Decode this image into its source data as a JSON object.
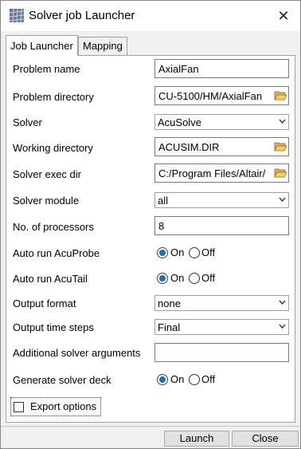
{
  "window": {
    "title": "Solver job Launcher",
    "close": "✕"
  },
  "tabs": [
    {
      "label": "Job Launcher",
      "active": true
    },
    {
      "label": "Mapping",
      "active": false
    }
  ],
  "form": {
    "problem_name": {
      "label": "Problem name",
      "value": "AxialFan"
    },
    "problem_directory": {
      "label": "Problem directory",
      "value": "CU-5100/HM/AxialFan"
    },
    "solver": {
      "label": "Solver",
      "value": "AcuSolve"
    },
    "working_directory": {
      "label": "Working directory",
      "value": "ACUSIM.DIR"
    },
    "solver_exec_dir": {
      "label": "Solver exec dir",
      "value": "C:/Program Files/Altair/"
    },
    "solver_module": {
      "label": "Solver module",
      "value": "all"
    },
    "num_processors": {
      "label": "No. of processors",
      "value": "8"
    },
    "auto_run_acuprobe": {
      "label": "Auto run AcuProbe",
      "on_label": "On",
      "off_label": "Off",
      "selected": "On"
    },
    "auto_run_acutail": {
      "label": "Auto run AcuTail",
      "on_label": "On",
      "off_label": "Off",
      "selected": "On"
    },
    "output_format": {
      "label": "Output format",
      "value": "none"
    },
    "output_time_steps": {
      "label": "Output time steps",
      "value": "Final"
    },
    "additional_args": {
      "label": "Additional solver arguments",
      "value": ""
    },
    "generate_deck": {
      "label": "Generate solver deck",
      "on_label": "On",
      "off_label": "Off",
      "selected": "On"
    },
    "export_options": {
      "label": "Export options",
      "checked": false
    }
  },
  "buttons": {
    "launch": "Launch",
    "close": "Close"
  },
  "colors": {
    "radio_selected": "#1f6fb5",
    "panel_bg": "#ffffff",
    "window_bg": "#f0f0f0"
  }
}
